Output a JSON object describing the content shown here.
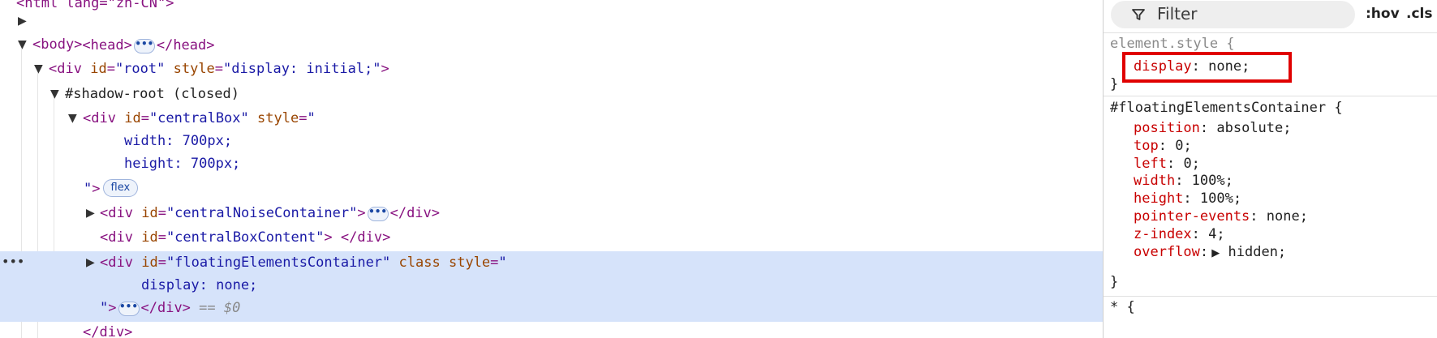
{
  "elements_panel": {
    "html_open": "<html lang=\"zh-CN\">",
    "head": {
      "open": "<head>",
      "close": "</head>"
    },
    "body_open": "<body>",
    "root": {
      "tag_open": "<div",
      "id_attr": "id",
      "id_val": "\"root\"",
      "style_attr": "style",
      "style_val": "\"display: initial;\"",
      "close": ">"
    },
    "shadow_root": "#shadow-root (closed)",
    "central_box": {
      "tag_open": "<div",
      "id_attr": "id",
      "id_val": "\"centralBox\"",
      "style_attr": "style",
      "style_open": "\"",
      "width_line": "width: 700px;",
      "height_line": "height: 700px;",
      "style_close": "\"",
      "tag_end": ">",
      "badge": "flex"
    },
    "noise": {
      "open": "<div",
      "id_attr": "id",
      "id_val": "\"centralNoiseContainer\"",
      "gt": ">",
      "close": "</div>"
    },
    "content": {
      "open": "<div",
      "id_attr": "id",
      "id_val": "\"centralBoxContent\"",
      "gt": ">",
      "close": " </div>"
    },
    "floating": {
      "open": "<div",
      "id_attr": "id",
      "id_val": "\"floatingElementsContainer\"",
      "class_attr": "class",
      "style_attr": "style",
      "style_open": "\"",
      "display_line": "display: none;",
      "style_close": "\"",
      "gt": ">",
      "close": "</div>",
      "dollar": " == $0"
    },
    "div_close": "</div>",
    "row_ellipsis": "•••",
    "ellipsis_badge": "•••"
  },
  "styles_panel": {
    "filter_placeholder": "Filter",
    "hov": ":hov",
    "cls": ".cls",
    "element_style": {
      "selector": "element.style {",
      "prop": "display",
      "value": " none;",
      "close": "}"
    },
    "floating_rule": {
      "selector": "#floatingElementsContainer {",
      "declarations": [
        {
          "prop": "position",
          "value": " absolute;"
        },
        {
          "prop": "top",
          "value": " 0;"
        },
        {
          "prop": "left",
          "value": " 0;"
        },
        {
          "prop": "width",
          "value": " 100%;"
        },
        {
          "prop": "height",
          "value": " 100%;"
        },
        {
          "prop": "pointer-events",
          "value": " none;"
        },
        {
          "prop": "z-index",
          "value": " 4;"
        },
        {
          "prop": "overflow",
          "value": " hidden;"
        }
      ],
      "close": "}"
    },
    "universal_rule": "* {"
  },
  "colors": {
    "selection": "#d6e3fa",
    "highlight_box": "#e00000",
    "tag": "#881280",
    "attr": "#994500",
    "attr_value": "#1a1aa6"
  }
}
